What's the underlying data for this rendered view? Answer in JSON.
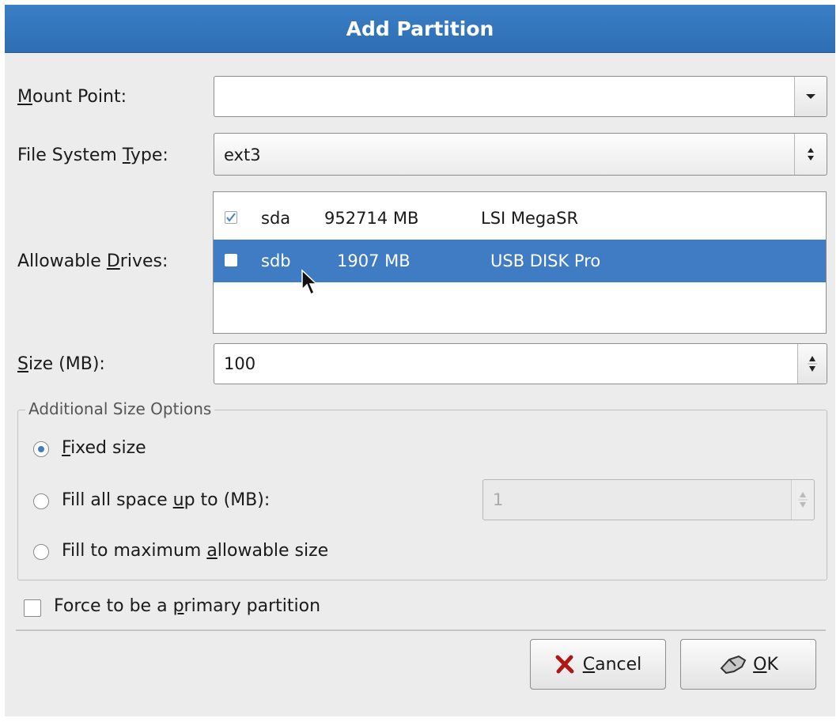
{
  "dialog": {
    "title": "Add Partition",
    "mount_point": {
      "label": "Mount Point:",
      "value": ""
    },
    "fs_type": {
      "label": "File System Type:",
      "value": "ext3"
    },
    "drives": {
      "label": "Allowable Drives:",
      "items": [
        {
          "checked": true,
          "name": "sda",
          "size": "952714 MB",
          "model": "LSI MegaSR",
          "selected": false
        },
        {
          "checked": false,
          "name": "sdb",
          "size": "1907 MB",
          "model": "USB DISK Pro",
          "selected": true
        }
      ]
    },
    "size": {
      "label": "Size (MB):",
      "value": "100"
    },
    "size_options": {
      "legend": "Additional Size Options",
      "fixed": "Fixed size",
      "fill_up_to": "Fill all space up to (MB):",
      "fill_up_to_value": "1",
      "fill_max": "Fill to maximum allowable size",
      "selected": "fixed"
    },
    "force_primary": {
      "label": "Force to be a primary partition",
      "checked": false
    },
    "buttons": {
      "cancel": "Cancel",
      "ok": "OK"
    }
  },
  "icons": [
    "dropdown-arrow-icon",
    "spin-arrows-icon",
    "checkbox-icon",
    "radio-icon",
    "mouse-cursor-icon",
    "cancel-x-icon",
    "ok-disk-icon"
  ],
  "colors": {
    "titlebar": "#2e6db2",
    "selection": "#3f7cc4"
  }
}
